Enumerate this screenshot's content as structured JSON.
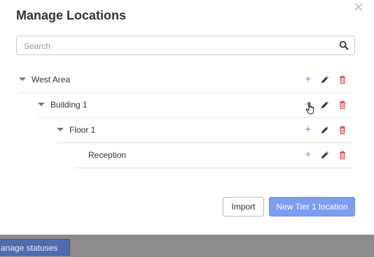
{
  "background": {
    "button_label": "anage statuses"
  },
  "modal": {
    "title": "Manage Locations",
    "search": {
      "placeholder": "Search",
      "value": ""
    },
    "tree": [
      {
        "label": "West Area",
        "expanded": true
      },
      {
        "label": "Building 1",
        "expanded": true
      },
      {
        "label": "Floor 1",
        "expanded": true
      },
      {
        "label": "Reception",
        "expanded": false
      }
    ],
    "row_actions": {
      "add_icon": "plus-icon",
      "edit_icon": "pencil-icon",
      "delete_icon": "trash-icon"
    },
    "footer": {
      "import_label": "Import",
      "new_label": "New Tier 1 location"
    }
  },
  "colors": {
    "primary_button": "#7d9df3",
    "add_icon": "#6f86c9",
    "edit_icon": "#333333",
    "delete_icon": "#d9534f"
  }
}
